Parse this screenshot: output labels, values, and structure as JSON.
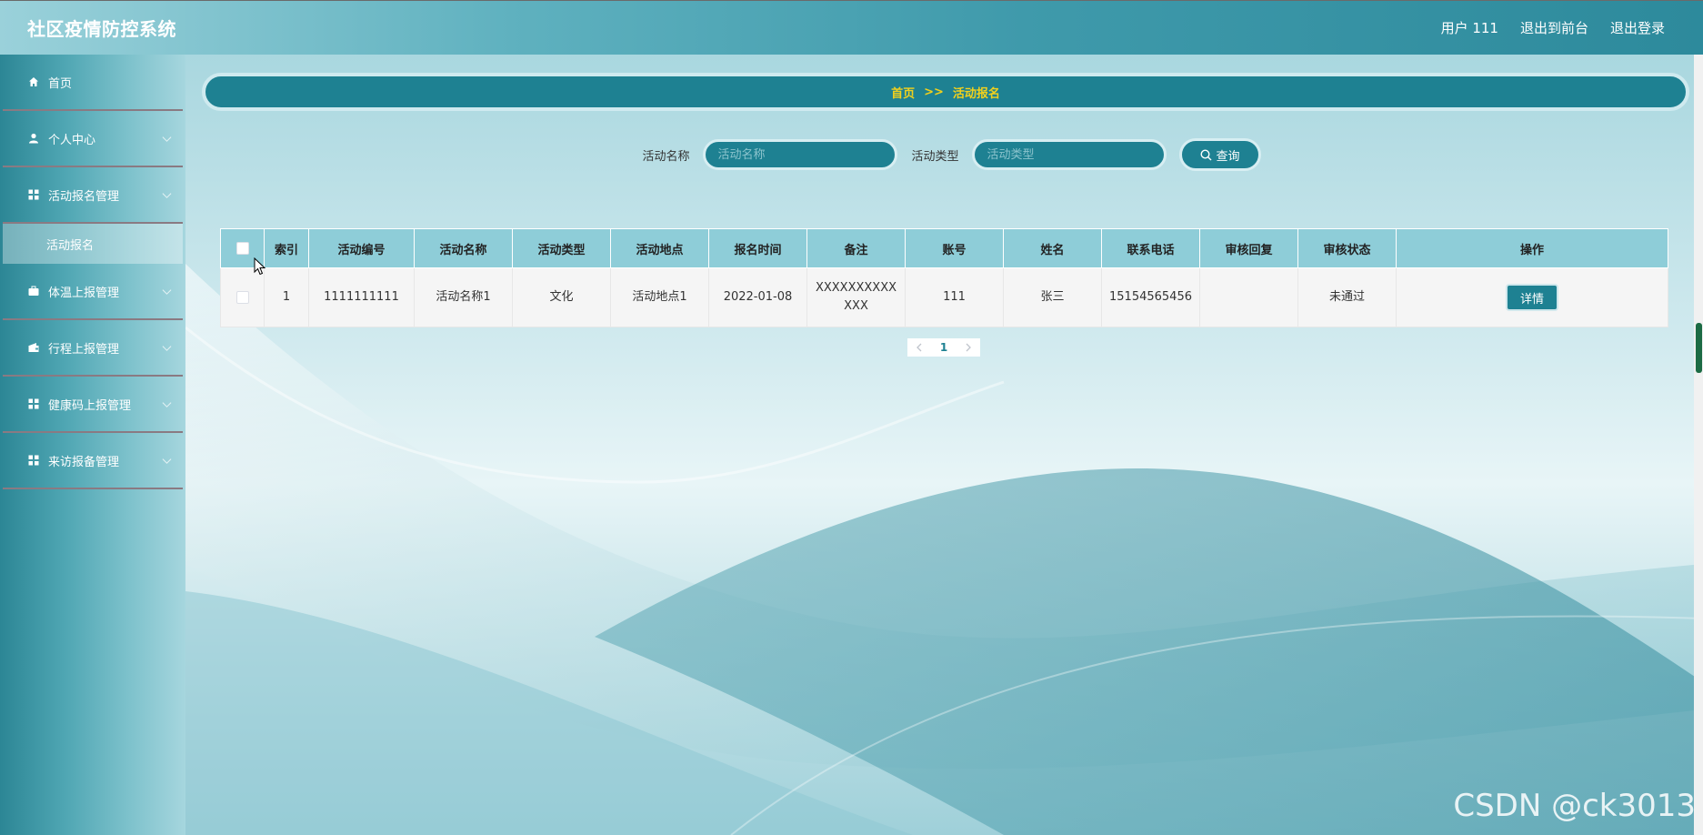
{
  "header": {
    "title": "社区疫情防控系统",
    "user": "用户 111",
    "to_front": "退出到前台",
    "logout": "退出登录"
  },
  "sidebar": {
    "items": [
      {
        "label": "首页",
        "icon": "home-icon"
      },
      {
        "label": "个人中心",
        "icon": "user-icon"
      },
      {
        "label": "活动报名管理",
        "icon": "grid-icon"
      },
      {
        "label": "体温上报管理",
        "icon": "briefcase-icon"
      },
      {
        "label": "行程上报管理",
        "icon": "wallet-icon"
      },
      {
        "label": "健康码上报管理",
        "icon": "grid-icon"
      },
      {
        "label": "来访报备管理",
        "icon": "grid-icon"
      }
    ],
    "active_sub": "活动报名"
  },
  "breadcrumb": {
    "home": "首页",
    "separator": ">>",
    "current": "活动报名"
  },
  "search": {
    "name_label": "活动名称",
    "name_placeholder": "活动名称",
    "type_label": "活动类型",
    "type_placeholder": "活动类型",
    "button_label": "查询"
  },
  "table": {
    "columns": [
      "索引",
      "活动编号",
      "活动名称",
      "活动类型",
      "活动地点",
      "报名时间",
      "备注",
      "账号",
      "姓名",
      "联系电话",
      "审核回复",
      "审核状态",
      "操作"
    ],
    "rows": [
      {
        "index": "1",
        "code": "1111111111",
        "name": "活动名称1",
        "type": "文化",
        "place": "活动地点1",
        "time": "2022-01-08",
        "remark": "XXXXXXXXXXXXX",
        "account": "111",
        "person": "张三",
        "phone": "15154565456",
        "reply": "",
        "status": "未通过",
        "action": "详情"
      }
    ]
  },
  "pagination": {
    "current": "1"
  },
  "watermark": "CSDN @ck3013",
  "colors": {
    "accent": "#1e8192",
    "breadcrumb_text": "#f2d11c",
    "table_header": "#8ecdd8"
  }
}
